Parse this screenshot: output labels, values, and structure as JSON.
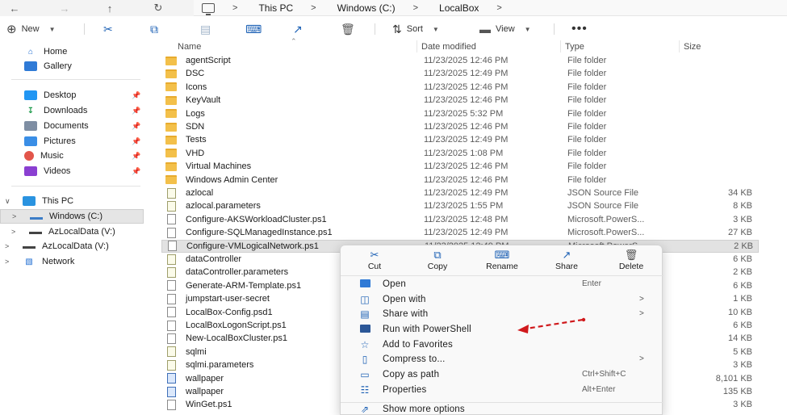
{
  "address_bar": {
    "back_icon": "arrow-left-icon",
    "forward_icon": "arrow-right-icon",
    "up_icon": "arrow-up-icon",
    "refresh_icon": "refresh-icon",
    "breadcrumbs": [
      "This PC",
      "Windows (C:)",
      "LocalBox"
    ],
    "separator": ">"
  },
  "command_bar": {
    "new_label": "New",
    "sort_label": "Sort",
    "view_label": "View",
    "more_label": "•••"
  },
  "sidebar": {
    "quick": [
      {
        "label": "Home",
        "icon": "home-icon"
      },
      {
        "label": "Gallery",
        "icon": "gallery-icon"
      }
    ],
    "pinned": [
      {
        "label": "Desktop",
        "icon": "desktop-icon"
      },
      {
        "label": "Downloads",
        "icon": "download-icon"
      },
      {
        "label": "Documents",
        "icon": "documents-icon"
      },
      {
        "label": "Pictures",
        "icon": "pictures-icon"
      },
      {
        "label": "Music",
        "icon": "music-icon"
      },
      {
        "label": "Videos",
        "icon": "videos-icon"
      }
    ],
    "tree": [
      {
        "label": "This PC",
        "expanded": true
      },
      {
        "label": "Windows (C:)",
        "selected": true
      },
      {
        "label": "AzLocalData (V:)"
      },
      {
        "label": "AzLocalData (V:)"
      },
      {
        "label": "Network"
      }
    ]
  },
  "columns": {
    "name": "Name",
    "date": "Date modified",
    "type": "Type",
    "size": "Size"
  },
  "files": [
    {
      "name": "agentScript",
      "date": "11/23/2025 12:46 PM",
      "type": "File folder",
      "size": "",
      "kind": "folder"
    },
    {
      "name": "DSC",
      "date": "11/23/2025 12:49 PM",
      "type": "File folder",
      "size": "",
      "kind": "folder"
    },
    {
      "name": "Icons",
      "date": "11/23/2025 12:46 PM",
      "type": "File folder",
      "size": "",
      "kind": "folder"
    },
    {
      "name": "KeyVault",
      "date": "11/23/2025 12:46 PM",
      "type": "File folder",
      "size": "",
      "kind": "folder"
    },
    {
      "name": "Logs",
      "date": "11/23/2025 5:32 PM",
      "type": "File folder",
      "size": "",
      "kind": "folder"
    },
    {
      "name": "SDN",
      "date": "11/23/2025 12:46 PM",
      "type": "File folder",
      "size": "",
      "kind": "folder"
    },
    {
      "name": "Tests",
      "date": "11/23/2025 12:49 PM",
      "type": "File folder",
      "size": "",
      "kind": "folder"
    },
    {
      "name": "VHD",
      "date": "11/23/2025 1:08 PM",
      "type": "File folder",
      "size": "",
      "kind": "folder"
    },
    {
      "name": "Virtual Machines",
      "date": "11/23/2025 12:46 PM",
      "type": "File folder",
      "size": "",
      "kind": "folder"
    },
    {
      "name": "Windows Admin Center",
      "date": "11/23/2025 12:46 PM",
      "type": "File folder",
      "size": "",
      "kind": "folder"
    },
    {
      "name": "azlocal",
      "date": "11/23/2025 12:49 PM",
      "type": "JSON Source File",
      "size": "34 KB",
      "kind": "json"
    },
    {
      "name": "azlocal.parameters",
      "date": "11/23/2025 1:55 PM",
      "type": "JSON Source File",
      "size": "8 KB",
      "kind": "json"
    },
    {
      "name": "Configure-AKSWorkloadCluster.ps1",
      "date": "11/23/2025 12:48 PM",
      "type": "Microsoft.PowerS...",
      "size": "3 KB",
      "kind": "doc"
    },
    {
      "name": "Configure-SQLManagedInstance.ps1",
      "date": "11/23/2025 12:49 PM",
      "type": "Microsoft.PowerS...",
      "size": "27 KB",
      "kind": "doc"
    },
    {
      "name": "Configure-VMLogicalNetwork.ps1",
      "date": "11/23/2025 12:49 PM",
      "type": "Microsoft.PowerS...",
      "size": "2 KB",
      "kind": "doc",
      "selected": true
    },
    {
      "name": "dataController",
      "date": "",
      "type": "",
      "size": "6 KB",
      "kind": "json"
    },
    {
      "name": "dataController.parameters",
      "date": "",
      "type": "",
      "size": "2 KB",
      "kind": "json"
    },
    {
      "name": "Generate-ARM-Template.ps1",
      "date": "",
      "type": "",
      "size": "6 KB",
      "kind": "doc"
    },
    {
      "name": "jumpstart-user-secret",
      "date": "",
      "type": "",
      "size": "1 KB",
      "kind": "doc"
    },
    {
      "name": "LocalBox-Config.psd1",
      "date": "",
      "type": "",
      "size": "10 KB",
      "kind": "doc"
    },
    {
      "name": "LocalBoxLogonScript.ps1",
      "date": "",
      "type": "",
      "size": "6 KB",
      "kind": "doc"
    },
    {
      "name": "New-LocalBoxCluster.ps1",
      "date": "",
      "type": "",
      "size": "14 KB",
      "kind": "doc"
    },
    {
      "name": "sqlmi",
      "date": "",
      "type": "",
      "size": "5 KB",
      "kind": "json"
    },
    {
      "name": "sqlmi.parameters",
      "date": "",
      "type": "",
      "size": "3 KB",
      "kind": "json"
    },
    {
      "name": "wallpaper",
      "date": "",
      "type": "",
      "size": "8,101 KB",
      "kind": "img"
    },
    {
      "name": "wallpaper",
      "date": "",
      "type": "",
      "size": "135 KB",
      "kind": "img"
    },
    {
      "name": "WinGet.ps1",
      "date": "",
      "type": "",
      "size": "3 KB",
      "kind": "doc"
    }
  ],
  "context_menu": {
    "quick_actions": [
      {
        "label": "Cut",
        "icon": "scissors-icon"
      },
      {
        "label": "Copy",
        "icon": "copy-icon"
      },
      {
        "label": "Rename",
        "icon": "rename-icon"
      },
      {
        "label": "Share",
        "icon": "share-icon"
      },
      {
        "label": "Delete",
        "icon": "trash-icon"
      }
    ],
    "items": [
      {
        "label": "Open",
        "shortcut": "Enter",
        "submenu": false,
        "icon": "open-icon"
      },
      {
        "label": "Open with",
        "shortcut": "",
        "submenu": true,
        "icon": "open-with-icon"
      },
      {
        "label": "Share with",
        "shortcut": "",
        "submenu": true,
        "icon": "share-with-icon"
      },
      {
        "label": "Run with PowerShell",
        "shortcut": "",
        "submenu": false,
        "icon": "powershell-icon"
      },
      {
        "label": "Add to Favorites",
        "shortcut": "",
        "submenu": false,
        "icon": "star-icon"
      },
      {
        "label": "Compress to...",
        "shortcut": "",
        "submenu": true,
        "icon": "zip-icon"
      },
      {
        "label": "Copy as path",
        "shortcut": "Ctrl+Shift+C",
        "submenu": false,
        "icon": "copy-path-icon"
      },
      {
        "label": "Properties",
        "shortcut": "Alt+Enter",
        "submenu": false,
        "icon": "properties-icon"
      },
      {
        "label": "Show more options",
        "shortcut": "",
        "submenu": false,
        "icon": "more-options-icon"
      }
    ]
  },
  "colors": {
    "accent": "#1a5fb4",
    "annotation_arrow": "#d0191c",
    "folder": "#f3c04a",
    "selection": "#e2e2e2"
  }
}
